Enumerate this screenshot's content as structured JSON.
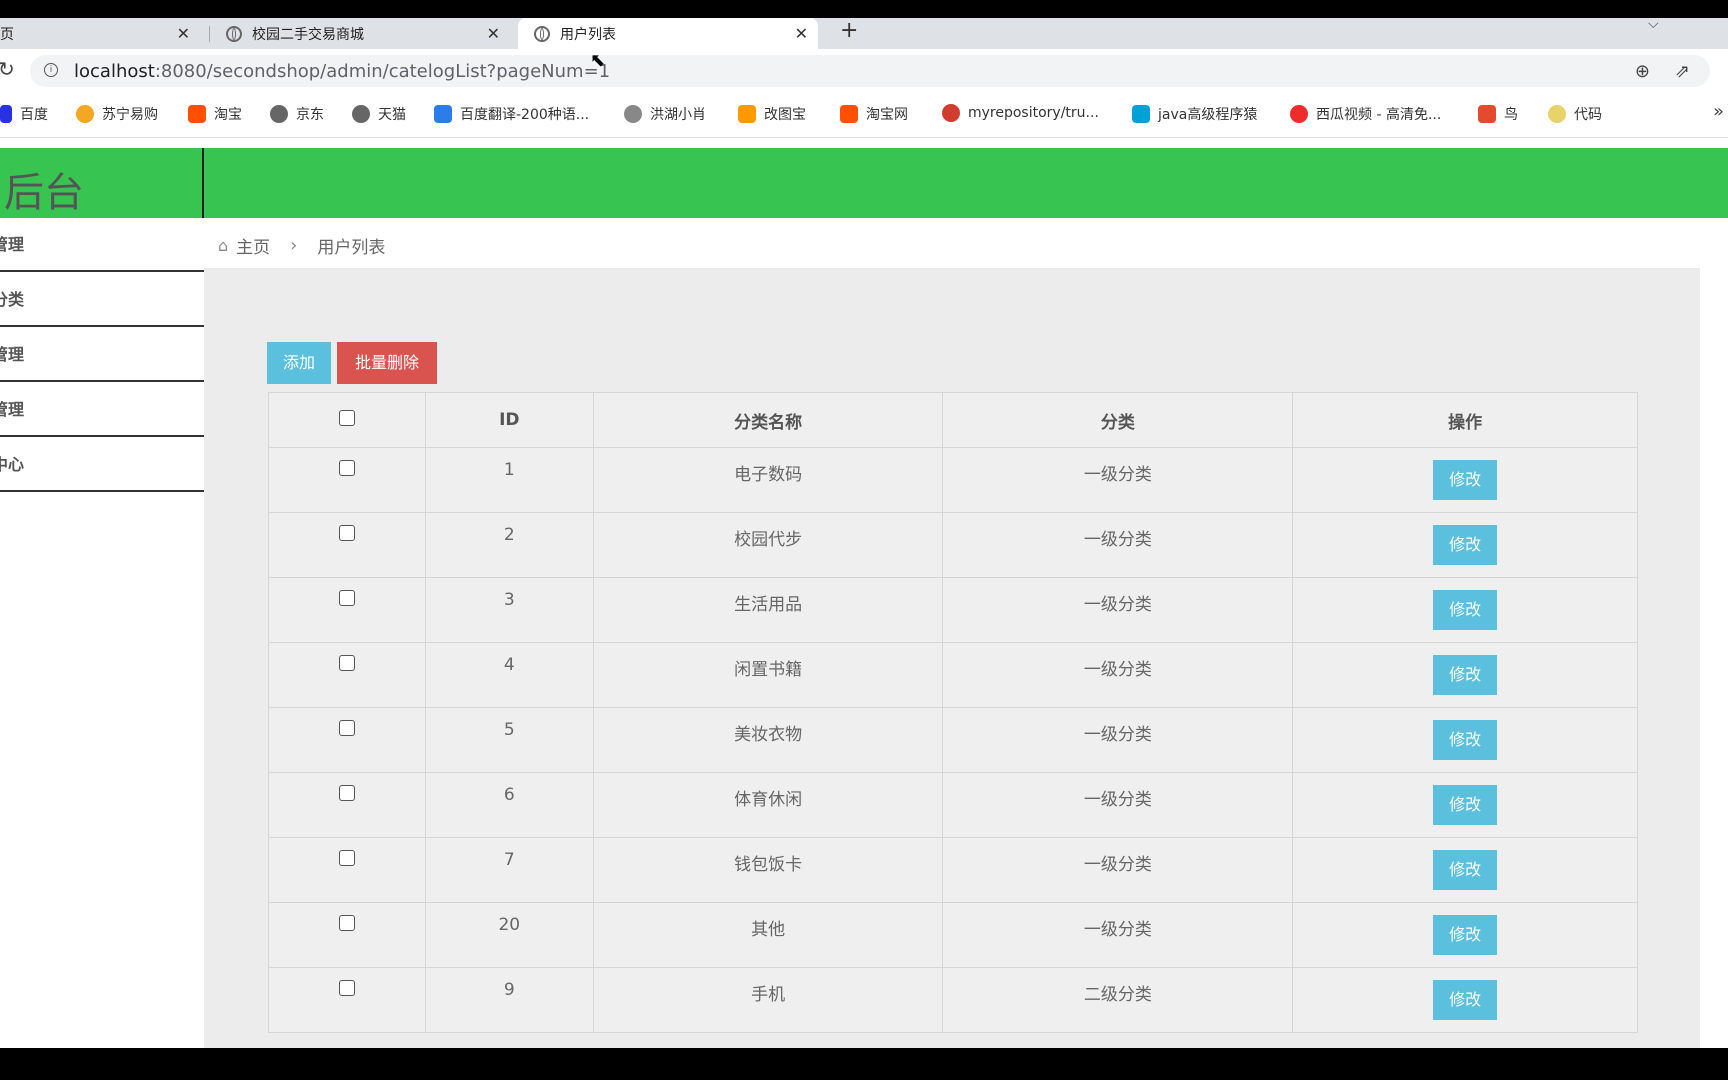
{
  "browser": {
    "tabs": [
      {
        "label": "页"
      },
      {
        "label": "校园二手交易商城"
      },
      {
        "label": "用户列表"
      }
    ],
    "close_glyph": "✕",
    "new_tab_glyph": "+",
    "url_host": "localhost",
    "url_path": ":8080/secondshop/admin/catelogList?pageNum=1",
    "bookmarks": [
      {
        "label": "百度",
        "color": "#2932e1"
      },
      {
        "label": "苏宁易购",
        "color": "#f5a623"
      },
      {
        "label": "淘宝",
        "color": "#ff5000"
      },
      {
        "label": "京东",
        "color": "#666666"
      },
      {
        "label": "天猫",
        "color": "#666666"
      },
      {
        "label": "百度翻译-200种语...",
        "color": "#2b7de9"
      },
      {
        "label": "洪湖小肖",
        "color": "#888888"
      },
      {
        "label": "改图宝",
        "color": "#ff9900"
      },
      {
        "label": "淘宝网",
        "color": "#ff5000"
      },
      {
        "label": "myrepository/tru...",
        "color": "#d03c2f"
      },
      {
        "label": "java高级程序猿",
        "color": "#00a1d6"
      },
      {
        "label": "西瓜视频 - 高清免...",
        "color": "#f02b2b"
      },
      {
        "label": "鸟",
        "color": "#e34b2e"
      },
      {
        "label": "代码",
        "color": "#e8d36a"
      }
    ],
    "more_glyph": "»"
  },
  "app": {
    "brand": "后台",
    "accent_color": "#37c451",
    "sidebar": [
      {
        "label": "管理"
      },
      {
        "label": "分类"
      },
      {
        "label": "管理"
      },
      {
        "label": "管理"
      },
      {
        "label": "中心"
      }
    ],
    "breadcrumb": {
      "home": "主页",
      "current": "用户列表",
      "sep": "›"
    },
    "buttons": {
      "add": "添加",
      "batch_delete": "批量删除"
    },
    "table": {
      "headers": {
        "id": "ID",
        "name": "分类名称",
        "level": "分类",
        "op": "操作"
      },
      "edit_label": "修改",
      "rows": [
        {
          "id": "1",
          "name": "电子数码",
          "level": "一级分类"
        },
        {
          "id": "2",
          "name": "校园代步",
          "level": "一级分类"
        },
        {
          "id": "3",
          "name": "生活用品",
          "level": "一级分类"
        },
        {
          "id": "4",
          "name": "闲置书籍",
          "level": "一级分类"
        },
        {
          "id": "5",
          "name": "美妆衣物",
          "level": "一级分类"
        },
        {
          "id": "6",
          "name": "体育休闲",
          "level": "一级分类"
        },
        {
          "id": "7",
          "name": "钱包饭卡",
          "level": "一级分类"
        },
        {
          "id": "20",
          "name": "其他",
          "level": "一级分类"
        },
        {
          "id": "9",
          "name": "手机",
          "level": "二级分类"
        }
      ]
    }
  }
}
